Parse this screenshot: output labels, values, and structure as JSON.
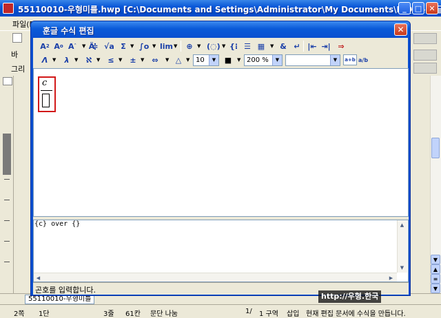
{
  "main_window": {
    "title": "55110010-우형미를.hwp [C:\\Documents and Settings\\Administrator\\My Documents\\ITQ\\] - 훈글",
    "menu_first": "파일(F)",
    "toolbar2_label": "바",
    "toolbar3_label": "그리"
  },
  "dialog": {
    "title": "훈글 수식 편집",
    "font_size": "10",
    "zoom": "200 %",
    "font_name": "",
    "formula": {
      "numerator": "c"
    },
    "script": "{c} over {}",
    "status": "곤호를 입력합니다."
  },
  "doc_tab": "55110010-우형미를",
  "status_bar": {
    "page": "2쪽",
    "section": "1단",
    "line": "3줄",
    "column": "61칸",
    "split": "문단 나눔",
    "page_count": "1/",
    "zone": "1 구역",
    "insert": "삽입",
    "message": "현재 편집 문서에 수식을 만듭니다."
  },
  "watermark": "http://우형.한국"
}
